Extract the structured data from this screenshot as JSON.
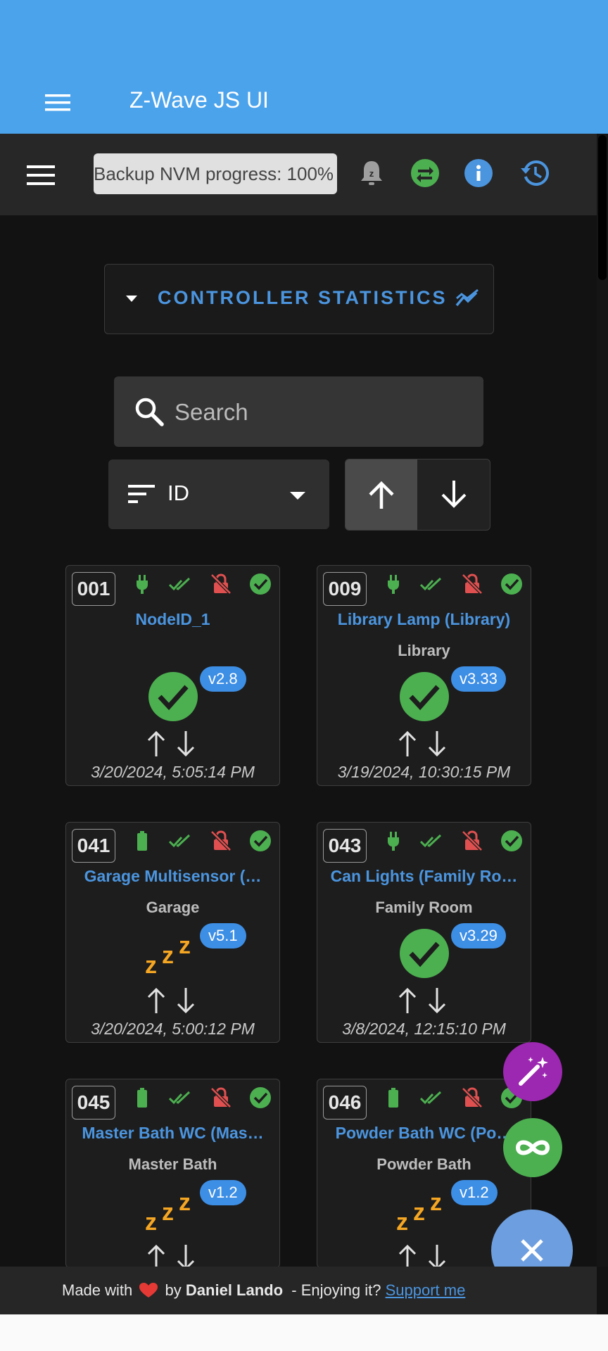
{
  "app": {
    "title": "Z-Wave JS UI"
  },
  "toolbar": {
    "progress_text": "Backup NVM progress: 100%",
    "progress_value": 100,
    "icons": [
      "alarm-snooze-icon",
      "swap-icon",
      "info-icon",
      "history-icon"
    ]
  },
  "controller_stats": {
    "label": "CONTROLLER STATISTICS"
  },
  "search": {
    "placeholder": "Search"
  },
  "sort": {
    "field": "ID"
  },
  "colors": {
    "accent": "#4b95df",
    "appbar": "#4ba3ec",
    "ok": "#4caf50",
    "sleep": "#f5a623",
    "danger": "#e05050",
    "fab_purple": "#9c27b0"
  },
  "nodes": [
    {
      "id": "001",
      "name": "NodeID_1",
      "location": "",
      "power": "plug",
      "status": "alive",
      "version": "v2.8",
      "date": "3/20/2024, 5:05:14 PM"
    },
    {
      "id": "009",
      "name": "Library Lamp (Library)",
      "location": "Library",
      "power": "plug",
      "status": "alive",
      "version": "v3.33",
      "date": "3/19/2024, 10:30:15 PM"
    },
    {
      "id": "041",
      "name": "Garage Multisensor (…",
      "location": "Garage",
      "power": "battery",
      "status": "asleep",
      "version": "v5.1",
      "date": "3/20/2024, 5:00:12 PM"
    },
    {
      "id": "043",
      "name": "Can Lights (Family Ro…",
      "location": "Family Room",
      "power": "plug",
      "status": "alive",
      "version": "v3.29",
      "date": "3/8/2024, 12:15:10 PM"
    },
    {
      "id": "045",
      "name": "Master Bath WC (Mas…",
      "location": "Master Bath",
      "power": "battery",
      "status": "asleep",
      "version": "v1.2",
      "date": ""
    },
    {
      "id": "046",
      "name": "Powder Bath WC (Po…",
      "location": "Powder Bath",
      "power": "battery",
      "status": "asleep",
      "version": "v1.2",
      "date": ""
    }
  ],
  "footer": {
    "made_with": "Made with",
    "by": "by",
    "author": "Daniel Lando",
    "enjoying": "- Enjoying it?",
    "support": "Support me"
  }
}
